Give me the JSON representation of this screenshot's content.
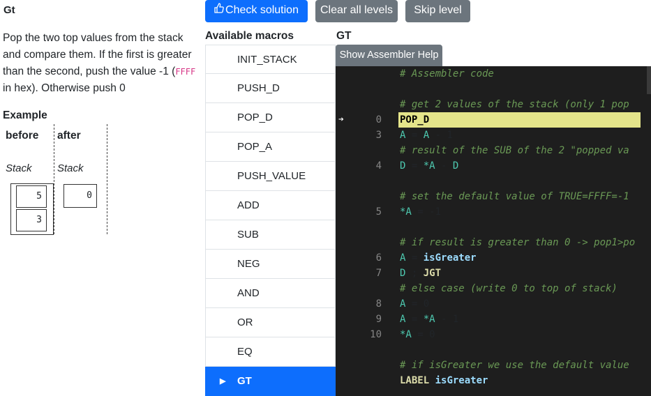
{
  "task": {
    "title": "Gt",
    "description_main": "Pop the two top values from the stack and compare them. If the first is greater than the second, push the value -1 (",
    "description_code": "FFFF",
    "description_tail": " in hex). Otherwise push 0",
    "example_title": "Example",
    "before_label": "before",
    "after_label": "after",
    "stack_label_before": "Stack",
    "stack_label_after": "Stack",
    "before_values": [
      "5",
      "3"
    ],
    "after_values": [
      "0"
    ]
  },
  "toolbar": {
    "check_label": "Check solution",
    "clear_label": "Clear all levels",
    "skip_label": "Skip level"
  },
  "macros": {
    "title": "Available macros",
    "items": [
      "INIT_STACK",
      "PUSH_D",
      "POP_D",
      "POP_A",
      "PUSH_VALUE",
      "ADD",
      "SUB",
      "NEG",
      "AND",
      "OR",
      "EQ",
      "GT"
    ],
    "active": "GT"
  },
  "editor": {
    "title": "GT",
    "help_label": "Show Assembler Help",
    "current_line": "0",
    "lines": [
      {
        "ln": "",
        "code": "# Assembler code"
      },
      {
        "ln": "",
        "code": ""
      },
      {
        "ln": "",
        "code": "# get 2 values of the stack (only 1 pop"
      },
      {
        "ln": "0",
        "code": "POP_D"
      },
      {
        "ln": "3",
        "code": "A = A - 1"
      },
      {
        "ln": "",
        "code": "# result of the SUB of the 2 \"popped va"
      },
      {
        "ln": "4",
        "code": "D = *A - D"
      },
      {
        "ln": "",
        "code": ""
      },
      {
        "ln": "",
        "code": "# set the default value of TRUE=FFFF=-1"
      },
      {
        "ln": "5",
        "code": "*A = -1"
      },
      {
        "ln": "",
        "code": ""
      },
      {
        "ln": "",
        "code": "# if result is greater than 0 -> pop1>po"
      },
      {
        "ln": "6",
        "code": "A = isGreater"
      },
      {
        "ln": "7",
        "code": "D ; JGT"
      },
      {
        "ln": "",
        "code": "# else case (write 0 to top of stack)"
      },
      {
        "ln": "8",
        "code": "A = 0"
      },
      {
        "ln": "9",
        "code": "A = *A - 1"
      },
      {
        "ln": "10",
        "code": "*A = 0"
      },
      {
        "ln": "",
        "code": ""
      },
      {
        "ln": "",
        "code": "# if isGreater we use the default value"
      },
      {
        "ln": "",
        "code": "LABEL isGreater"
      }
    ]
  },
  "colors": {
    "primary": "#0d6efd",
    "secondary": "#6c757d",
    "editor_bg": "#1e1e1e",
    "highlight": "#e4e48a"
  }
}
